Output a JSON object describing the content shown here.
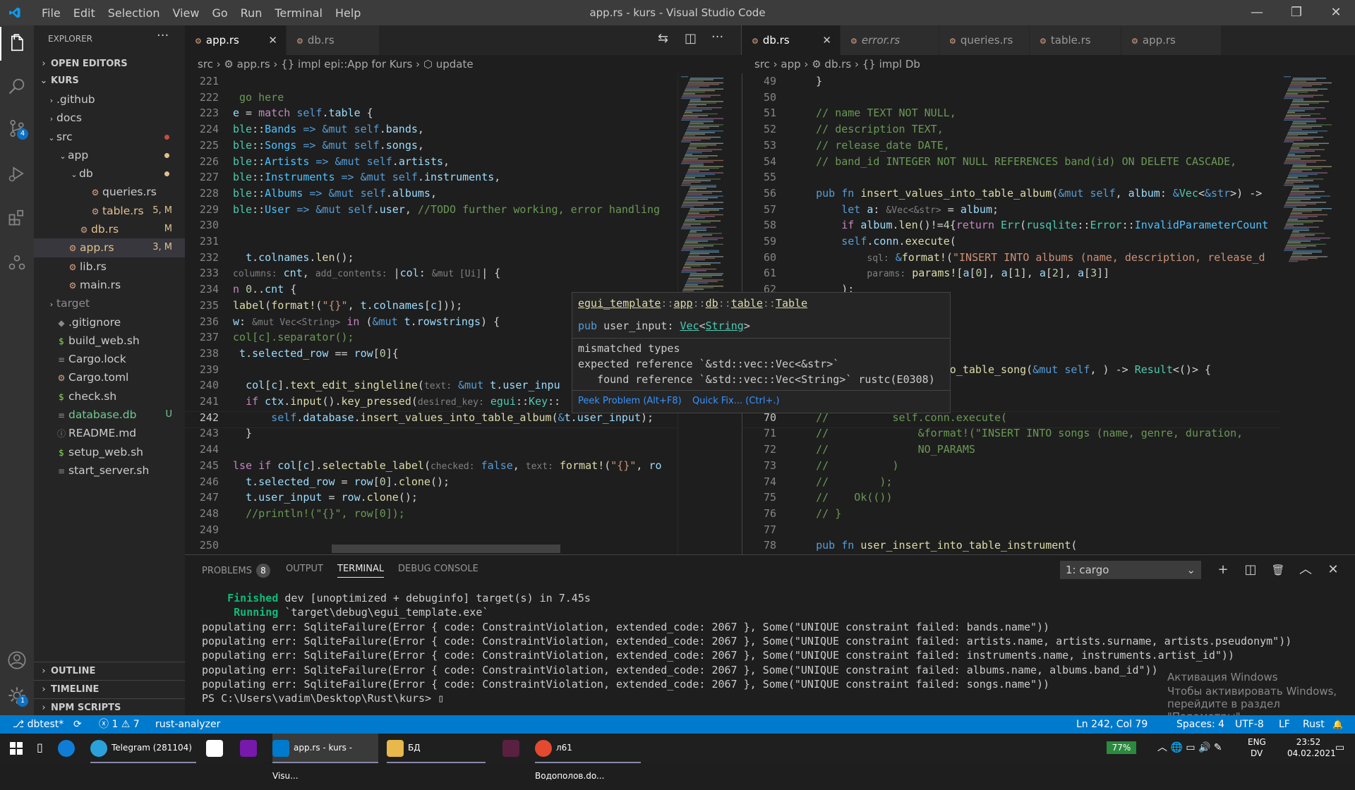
{
  "window": {
    "title": "app.rs - kurs - Visual Studio Code",
    "menu": [
      "File",
      "Edit",
      "Selection",
      "View",
      "Go",
      "Run",
      "Terminal",
      "Help"
    ],
    "minimize": "—",
    "maximize": "❐",
    "close": "✕"
  },
  "activity": {
    "scm_badge": "4",
    "settings_badge": "1"
  },
  "sidebar": {
    "header": "EXPLORER",
    "more": "···",
    "open_editors": "OPEN EDITORS",
    "root": "KURS",
    "tree": [
      {
        "indent": 1,
        "twisty": "›",
        "icon": "",
        "name": ".github",
        "status": "",
        "dot": ""
      },
      {
        "indent": 1,
        "twisty": "›",
        "icon": "",
        "name": "docs",
        "status": "",
        "dot": ""
      },
      {
        "indent": 1,
        "twisty": "⌄",
        "icon": "",
        "name": "src",
        "status": "",
        "dot": "#c74e39"
      },
      {
        "indent": 2,
        "twisty": "⌄",
        "icon": "",
        "name": "app",
        "status": "",
        "dot": "#e2c08d"
      },
      {
        "indent": 3,
        "twisty": "⌄",
        "icon": "",
        "name": "db",
        "status": "",
        "dot": "#e2c08d"
      },
      {
        "indent": 4,
        "twisty": "",
        "icon": "⚙",
        "name": "queries.rs",
        "status": "",
        "dot": ""
      },
      {
        "indent": 4,
        "twisty": "",
        "icon": "⚙",
        "name": "table.rs",
        "status": "5, M",
        "dot": "",
        "color": "#e2c08d"
      },
      {
        "indent": 3,
        "twisty": "",
        "icon": "⚙",
        "name": "db.rs",
        "status": "M",
        "dot": "",
        "color": "#e2c08d"
      },
      {
        "indent": 2,
        "twisty": "",
        "icon": "⚙",
        "name": "app.rs",
        "status": "3, M",
        "dot": "",
        "color": "#e2c08d",
        "selected": true
      },
      {
        "indent": 2,
        "twisty": "",
        "icon": "⚙",
        "name": "lib.rs",
        "status": "",
        "dot": ""
      },
      {
        "indent": 2,
        "twisty": "",
        "icon": "⚙",
        "name": "main.rs",
        "status": "",
        "dot": ""
      },
      {
        "indent": 1,
        "twisty": "›",
        "icon": "",
        "name": "target",
        "status": "",
        "dot": "",
        "color": "#8c8c8c"
      },
      {
        "indent": 1,
        "twisty": "",
        "icon": "◆",
        "name": ".gitignore",
        "status": "",
        "dot": ""
      },
      {
        "indent": 1,
        "twisty": "",
        "icon": "$",
        "name": "build_web.sh",
        "status": "",
        "dot": ""
      },
      {
        "indent": 1,
        "twisty": "",
        "icon": "≡",
        "name": "Cargo.lock",
        "status": "",
        "dot": ""
      },
      {
        "indent": 1,
        "twisty": "",
        "icon": "⚙",
        "name": "Cargo.toml",
        "status": "",
        "dot": ""
      },
      {
        "indent": 1,
        "twisty": "",
        "icon": "$",
        "name": "check.sh",
        "status": "",
        "dot": ""
      },
      {
        "indent": 1,
        "twisty": "",
        "icon": "≡",
        "name": "database.db",
        "status": "U",
        "dot": "",
        "color": "#73c991"
      },
      {
        "indent": 1,
        "twisty": "",
        "icon": "ⓘ",
        "name": "README.md",
        "status": "",
        "dot": ""
      },
      {
        "indent": 1,
        "twisty": "",
        "icon": "$",
        "name": "setup_web.sh",
        "status": "",
        "dot": ""
      },
      {
        "indent": 1,
        "twisty": "",
        "icon": "≡",
        "name": "start_server.sh",
        "status": "",
        "dot": ""
      }
    ],
    "outline": "OUTLINE",
    "timeline": "TIMELINE",
    "npm": "NPM SCRIPTS"
  },
  "editor_left": {
    "tabs": [
      {
        "name": "app.rs",
        "active": true,
        "close": "✕"
      },
      {
        "name": "db.rs",
        "active": false
      }
    ],
    "breadcrumb": "src  ›  ⚙ app.rs  ›  {} impl epi::App for Kurs  ›  ⬡ update",
    "lines": [
      {
        "n": "221",
        "h": ""
      },
      {
        "n": "222",
        "h": "<span class=\"c\"> go here</span>"
      },
      {
        "n": "223",
        "h": "<span class=\"v\">e</span> = <span class=\"p\">match</span> <span class=\"k\">self</span>.<span class=\"v\">table</span> {"
      },
      {
        "n": "224",
        "h": "<span class=\"t\">ble</span>::<span class=\"m\">Bands</span> <span class=\"k\">=></span> <span class=\"k\">&amp;mut</span> <span class=\"k\">self</span>.<span class=\"v\">bands</span>,"
      },
      {
        "n": "225",
        "h": "<span class=\"t\">ble</span>::<span class=\"m\">Songs</span> <span class=\"k\">=></span> <span class=\"k\">&amp;mut</span> <span class=\"k\">self</span>.<span class=\"v\">songs</span>,"
      },
      {
        "n": "226",
        "h": "<span class=\"t\">ble</span>::<span class=\"m\">Artists</span> <span class=\"k\">=></span> <span class=\"k\">&amp;mut</span> <span class=\"k\">self</span>.<span class=\"v\">artists</span>,"
      },
      {
        "n": "227",
        "h": "<span class=\"t\">ble</span>::<span class=\"m\">Instruments</span> <span class=\"k\">=></span> <span class=\"k\">&amp;mut</span> <span class=\"k\">self</span>.<span class=\"v\">instruments</span>,"
      },
      {
        "n": "228",
        "h": "<span class=\"t\">ble</span>::<span class=\"m\">Albums</span> <span class=\"k\">=></span> <span class=\"k\">&amp;mut</span> <span class=\"k\">self</span>.<span class=\"v\">albums</span>,"
      },
      {
        "n": "229",
        "h": "<span class=\"t\">ble</span>::<span class=\"m\">User</span> <span class=\"k\">=></span> <span class=\"k\">&amp;mut</span> <span class=\"k\">self</span>.<span class=\"v\">user</span>, <span class=\"c\">//TODO further working, error handling</span>"
      },
      {
        "n": "230",
        "h": ""
      },
      {
        "n": "231",
        "h": ""
      },
      {
        "n": "232",
        "h": "  <span class=\"v\">t</span>.<span class=\"v\">colnames</span>.<span class=\"f\">len</span>();"
      },
      {
        "n": "233",
        "h": "<span class=\"h\">columns:</span> <span class=\"v\">cnt</span>, <span class=\"h\">add_contents:</span> |<span class=\"v\">col</span>: <span class=\"h\">&amp;mut [Ui]</span>| {"
      },
      {
        "n": "234",
        "h": "<span class=\"p\">n</span> <span class=\"n\">0</span>..<span class=\"v\">cnt</span> {"
      },
      {
        "n": "235",
        "h": "<span class=\"f\">label</span>(<span class=\"f\">format!</span>(<span class=\"s\">\"{}\"</span>, <span class=\"v\">t</span>.<span class=\"v\">colnames</span>[<span class=\"v\">c</span>]));"
      },
      {
        "n": "236",
        "h": "<span class=\"v\">w</span>: <span class=\"h\">&amp;mut Vec&lt;String&gt;</span> <span class=\"p\">in</span> (<span class=\"k\">&amp;mut</span> <span class=\"v\">t</span>.<span class=\"v\">rowstrings</span>) {"
      },
      {
        "n": "237",
        "h": "<span class=\"c\">col[c].separator();</span>"
      },
      {
        "n": "238",
        "h": " <span class=\"v\">t</span>.<span class=\"v\">selected_row</span> == <span class=\"v\">row</span>[<span class=\"n\">0</span>]{"
      },
      {
        "n": "239",
        "h": ""
      },
      {
        "n": "240",
        "h": "  <span class=\"v\">col</span>[<span class=\"v\">c</span>].<span class=\"f\">text_edit_singleline</span>(<span class=\"h\">text:</span> <span class=\"k\">&amp;mut</span> <span class=\"v\">t</span>.<span class=\"v\">user_inpu</span>"
      },
      {
        "n": "241",
        "h": "  <span class=\"p\">if</span> <span class=\"v\">ctx</span>.<span class=\"f\">input</span>().<span class=\"f\">key_pressed</span>(<span class=\"h\">desired_key:</span> <span class=\"t\">egui</span>::<span class=\"t\">Key</span>::"
      },
      {
        "n": "242",
        "h": "      <span class=\"k\">self</span>.<span class=\"v\">database</span>.<span class=\"f\">insert_values_into_table_album</span>(<span class=\"k\">&amp;</span><span class=\"v\">t</span>.<span class=\"v\">user_input</span>);"
      },
      {
        "n": "243",
        "h": "  }"
      },
      {
        "n": "244",
        "h": ""
      },
      {
        "n": "245",
        "h": "<span class=\"p\">lse if</span> <span class=\"v\">col</span>[<span class=\"v\">c</span>].<span class=\"f\">selectable_label</span>(<span class=\"h\">checked:</span> <span class=\"k\">false</span>, <span class=\"h\">text:</span> <span class=\"f\">format!</span>(<span class=\"s\">\"{}\"</span>, <span class=\"v\">ro</span>"
      },
      {
        "n": "246",
        "h": "  <span class=\"v\">t</span>.<span class=\"v\">selected_row</span> = <span class=\"v\">row</span>[<span class=\"n\">0</span>].<span class=\"f\">clone</span>();"
      },
      {
        "n": "247",
        "h": "  <span class=\"v\">t</span>.<span class=\"v\">user_input</span> = <span class=\"v\">row</span>.<span class=\"f\">clone</span>();"
      },
      {
        "n": "248",
        "h": "  <span class=\"c\">//println!(\"{}\", row[0]);</span>"
      },
      {
        "n": "249",
        "h": ""
      },
      {
        "n": "250",
        "h": ""
      }
    ]
  },
  "editor_right": {
    "tabs": [
      {
        "name": "db.rs",
        "active": true,
        "close": "✕"
      },
      {
        "name": "error.rs",
        "active": false,
        "italic": true
      },
      {
        "name": "queries.rs",
        "active": false
      },
      {
        "name": "table.rs",
        "active": false
      },
      {
        "name": "app.rs",
        "active": false
      }
    ],
    "breadcrumb": "src  ›  app  ›  ⚙ db.rs  ›  {} impl Db",
    "lines": [
      {
        "n": "49",
        "h": "    }"
      },
      {
        "n": "50",
        "h": ""
      },
      {
        "n": "51",
        "h": "    <span class=\"c\">// name TEXT NOT NULL,</span>"
      },
      {
        "n": "52",
        "h": "    <span class=\"c\">// description TEXT,</span>"
      },
      {
        "n": "53",
        "h": "    <span class=\"c\">// release_date DATE,</span>"
      },
      {
        "n": "54",
        "h": "    <span class=\"c\">// band_id INTEGER NOT NULL REFERENCES band(id) ON DELETE CASCADE,</span>"
      },
      {
        "n": "55",
        "h": ""
      },
      {
        "n": "56",
        "h": "    <span class=\"k\">pub fn</span> <span class=\"f\">insert_values_into_table_album</span>(<span class=\"k\">&amp;mut self</span>, <span class=\"v\">album</span>: <span class=\"k\">&amp;</span><span class=\"t\">Vec</span>&lt;<span class=\"k\">&amp;str</span>&gt;) -&gt;"
      },
      {
        "n": "57",
        "h": "        <span class=\"k\">let</span> <span class=\"v\">a</span>: <span class=\"h\">&amp;Vec&lt;&amp;str&gt;</span> = <span class=\"v\">album</span>;"
      },
      {
        "n": "58",
        "h": "        <span class=\"p\">if</span> <span class=\"v\">album</span>.<span class=\"f\">len</span>()!=<span class=\"n\">4</span>{<span class=\"p\">return</span> <span class=\"t\">Err</span>(<span class=\"t\">rusqlite</span>::<span class=\"t\">Error</span>::<span class=\"m\">InvalidParameterCount</span>"
      },
      {
        "n": "59",
        "h": "        <span class=\"k\">self</span>.<span class=\"v\">conn</span>.<span class=\"f\">execute</span>("
      },
      {
        "n": "60",
        "h": "            <span class=\"h\">sql:</span> <span class=\"k\">&amp;</span><span class=\"f\">format!</span>(<span class=\"s\">\"INSERT INTO albums (name, description, release_d</span>"
      },
      {
        "n": "61",
        "h": "            <span class=\"h\">params:</span> <span class=\"f\">params!</span>[<span class=\"v\">a</span>[<span class=\"n\">0</span>], <span class=\"v\">a</span>[<span class=\"n\">1</span>], <span class=\"v\">a</span>[<span class=\"n\">2</span>], <span class=\"v\">a</span>[<span class=\"n\">3</span>]]"
      },
      {
        "n": "62",
        "h": "        );"
      },
      {
        "n": "63",
        "h": ""
      },
      {
        "n": "64",
        "h": ""
      },
      {
        "n": "65",
        "h": ""
      },
      {
        "n": "66",
        "h": ""
      },
      {
        "n": "67",
        "h": "                     <span class=\"f\">_into_table_song</span>(<span class=\"k\">&amp;mut self</span>, ) -&gt; <span class=\"t\">Result</span>&lt;()&gt; {"
      },
      {
        "n": "68",
        "h": "                     ("
      },
      {
        "n": "69",
        "h": "                     <span class=\"s\">)\"</span>,"
      },
      {
        "n": "70",
        "h": "    <span class=\"c\">//          self.conn.execute(</span>"
      },
      {
        "n": "71",
        "h": "    <span class=\"c\">//              &amp;format!(\"INSERT INTO songs (name, genre, duration,</span>"
      },
      {
        "n": "72",
        "h": "    <span class=\"c\">//              NO_PARAMS</span>"
      },
      {
        "n": "73",
        "h": "    <span class=\"c\">//          )</span>"
      },
      {
        "n": "74",
        "h": "    <span class=\"c\">//        );</span>"
      },
      {
        "n": "75",
        "h": "    <span class=\"c\">//    Ok(())</span>"
      },
      {
        "n": "76",
        "h": "    <span class=\"c\">// }</span>"
      },
      {
        "n": "77",
        "h": ""
      },
      {
        "n": "78",
        "h": "    <span class=\"k\">pub fn</span> <span class=\"f\">user_insert_into_table_instrument</span>("
      }
    ]
  },
  "hover": {
    "path": "<span style=\"color:#dcdcaa;text-decoration:underline\">egui_template</span><span style=\"color:#888\">::</span><span style=\"color:#dcdcaa;text-decoration:underline\">app</span><span style=\"color:#888\">::</span><span style=\"color:#dcdcaa;text-decoration:underline\">db</span><span style=\"color:#888\">::</span><span style=\"color:#dcdcaa;text-decoration:underline\">table</span><span style=\"color:#888\">::</span><span style=\"color:#dcdcaa;text-decoration:underline\">Table</span>",
    "decl": "<span class=\"k\">pub</span> <span style=\"color:#ccc\">user_input</span>: <span style=\"color:#4ec9b0;text-decoration:underline\">Vec</span>&lt;<span style=\"color:#4ec9b0;text-decoration:underline\">String</span>&gt;",
    "err1": "mismatched types",
    "err2": "expected reference `&std::vec::Vec<&str>`",
    "err3": "   found reference `&std::vec::Vec<String>` rustc(E0308)",
    "peek": "Peek Problem (Alt+F8)",
    "quickfix": "Quick Fix... (Ctrl+.)"
  },
  "panel": {
    "tabs": [
      {
        "label": "PROBLEMS",
        "badge": "8"
      },
      {
        "label": "OUTPUT"
      },
      {
        "label": "TERMINAL",
        "active": true
      },
      {
        "label": "DEBUG CONSOLE"
      }
    ],
    "terminal_select": "1: cargo",
    "icons": [
      "+",
      "◫",
      "🗑",
      "︿",
      "✕"
    ],
    "lines": [
      "<span class=\"grn\">    Finished</span> dev [unoptimized + debuginfo] target(s) in 7.45s",
      "<span class=\"grn\">     Running</span> `target\\debug\\egui_template.exe`",
      "populating err: SqliteFailure(Error { code: ConstraintViolation, extended_code: 2067 }, Some(\"UNIQUE constraint failed: bands.name\"))",
      "populating err: SqliteFailure(Error { code: ConstraintViolation, extended_code: 2067 }, Some(\"UNIQUE constraint failed: artists.name, artists.surname, artists.pseudonym\"))",
      "populating err: SqliteFailure(Error { code: ConstraintViolation, extended_code: 2067 }, Some(\"UNIQUE constraint failed: instruments.name, instruments.artist_id\"))",
      "populating err: SqliteFailure(Error { code: ConstraintViolation, extended_code: 2067 }, Some(\"UNIQUE constraint failed: albums.name, albums.band_id\"))",
      "populating err: SqliteFailure(Error { code: ConstraintViolation, extended_code: 2067 }, Some(\"UNIQUE constraint failed: songs.name\"))",
      "PS C:\\Users\\vadim\\Desktop\\Rust\\kurs> ▯"
    ],
    "watermark1": "Активация Windows",
    "watermark2": "Чтобы активировать Windows, перейдите в раздел \"Параметры\"."
  },
  "statusbar": {
    "branch": "⎇ dbtest*",
    "sync": "⟳",
    "problems": "ⓧ 1 ⚠ 7",
    "analyzer": "rust-analyzer",
    "position": "Ln 242, Col 79",
    "spaces": "Spaces: 4",
    "encoding": "UTF-8",
    "eol": "LF",
    "language": "Rust",
    "feedback": "☺",
    "bell": "🔔"
  },
  "taskbar": {
    "items": [
      {
        "label": "Telegram (281104)",
        "color": "#2aa1da"
      },
      {
        "label": "app.rs - kurs - Visu...",
        "color": "#007acc"
      },
      {
        "label": "БД",
        "color": "#e8b84a"
      },
      {
        "label": "л61 Водополов.do...",
        "color": "#e34a2f"
      }
    ],
    "battery": "77%",
    "lang1": "ENG",
    "lang2": "DV",
    "time": "23:52",
    "date": "04.02.2021",
    "colors": {
      "telegram": "#2aa1da",
      "vscode": "#007acc",
      "folder": "#e8b84a",
      "firefox": "#e34a2f",
      "onenote": "#7719aa"
    }
  }
}
